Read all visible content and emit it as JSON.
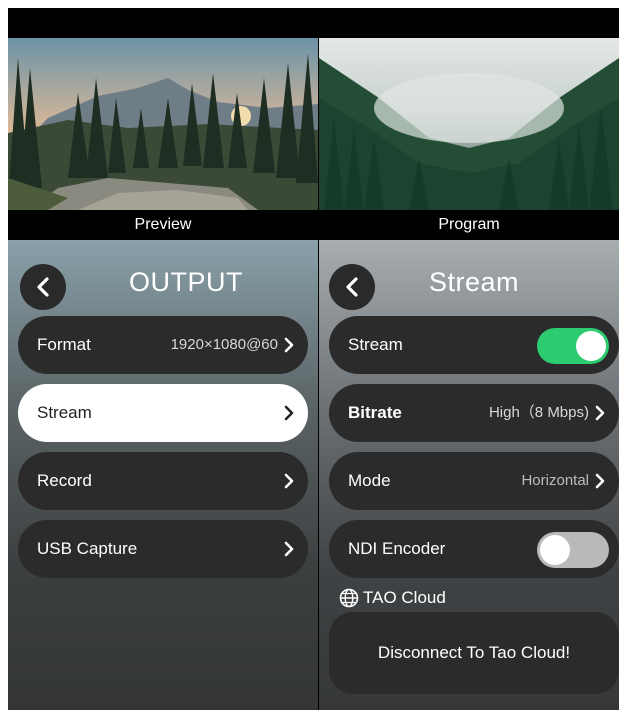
{
  "preview": {
    "label": "Preview"
  },
  "program": {
    "label": "Program"
  },
  "output_panel": {
    "title": "OUTPUT",
    "items": [
      {
        "label": "Format",
        "value": "1920×1080@60"
      },
      {
        "label": "Stream",
        "value": ""
      },
      {
        "label": "Record",
        "value": ""
      },
      {
        "label": "USB Capture",
        "value": ""
      }
    ]
  },
  "stream_panel": {
    "title": "Stream",
    "stream_toggle": {
      "label": "Stream",
      "on": true
    },
    "bitrate": {
      "label": "Bitrate",
      "value": "High（8 Mbps)"
    },
    "mode": {
      "label": "Mode",
      "value": "Horizontal"
    },
    "ndi": {
      "label": "NDI Encoder",
      "on": false
    },
    "cloud_label": "TAO Cloud",
    "disconnect_label": "Disconnect To Tao Cloud!"
  },
  "colors": {
    "toggle_on": "#2ecc71",
    "toggle_off": "#b9b9b9",
    "row_bg": "#2b2b2b",
    "selected_row_bg": "#ffffff"
  },
  "icons": [
    "chevron-left-icon",
    "chevron-right-icon",
    "globe-icon"
  ]
}
